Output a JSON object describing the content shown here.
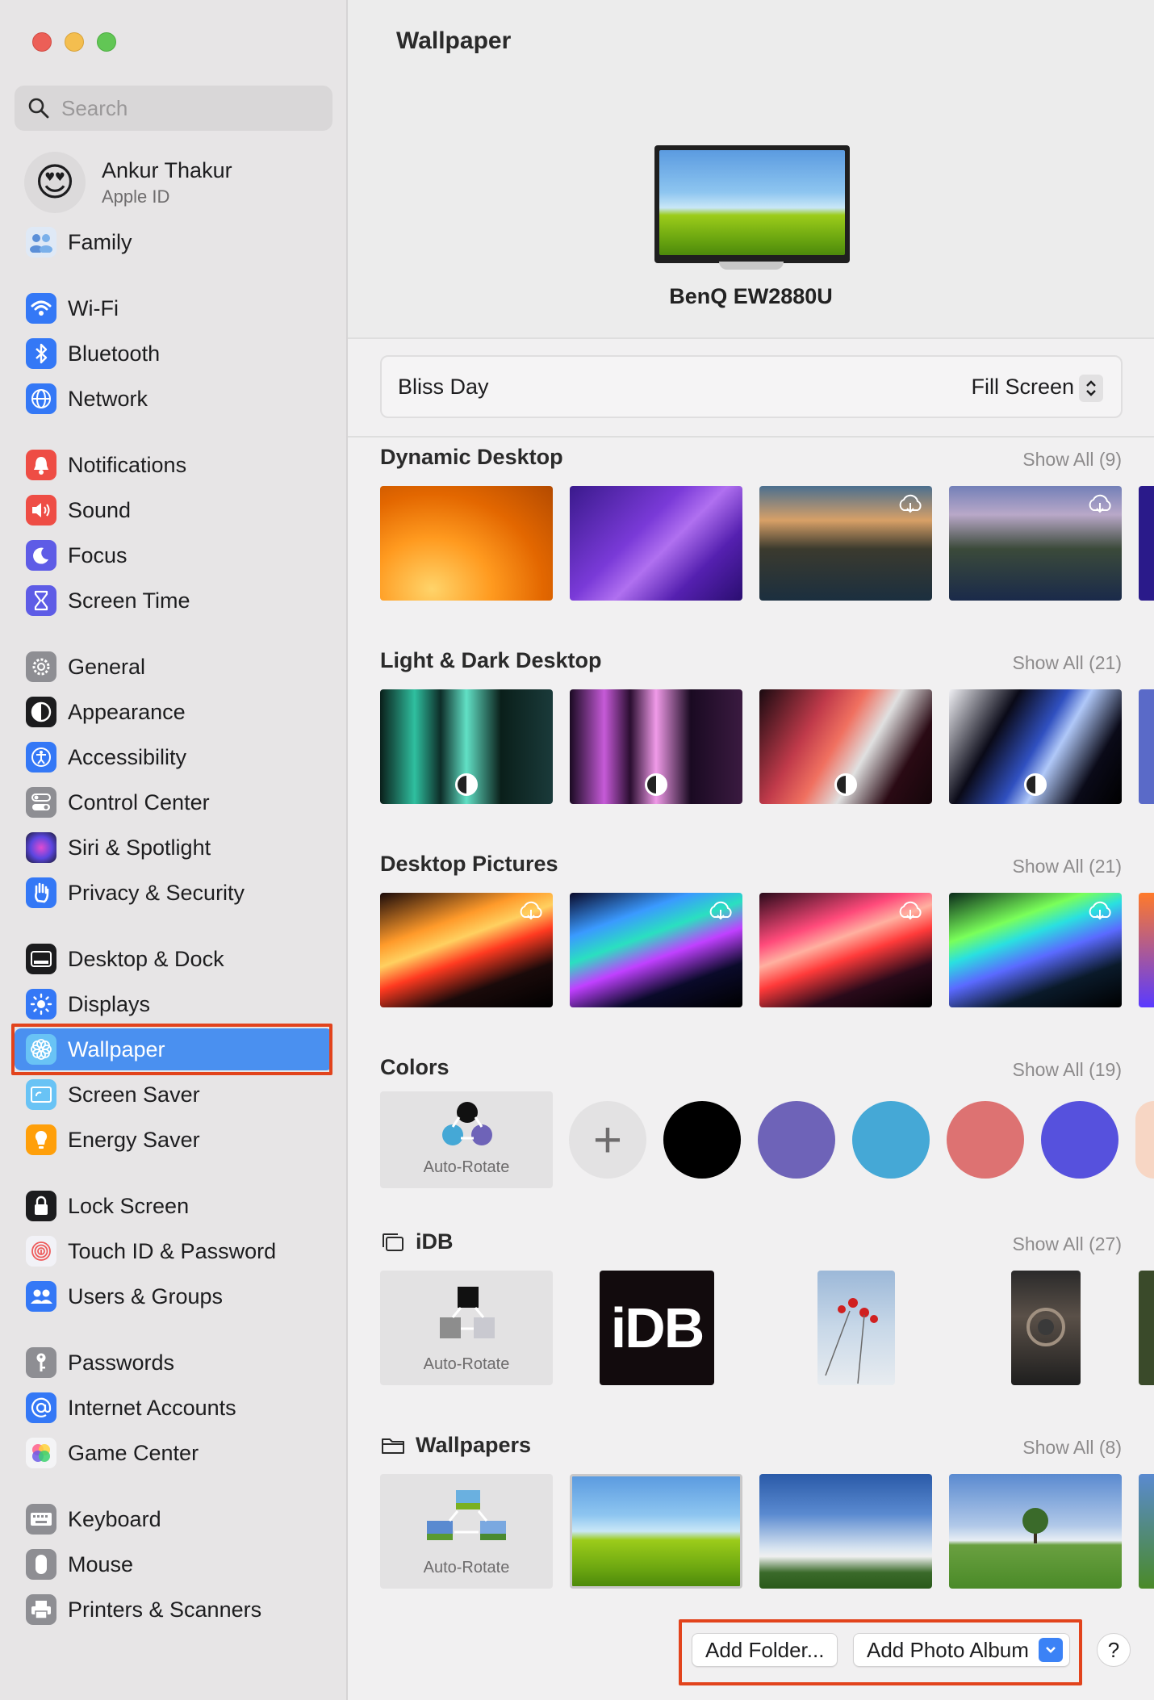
{
  "sidebar": {
    "search_placeholder": "Search",
    "profile": {
      "name": "Ankur Thakur",
      "subtitle": "Apple ID",
      "avatar": "😍"
    },
    "items": [
      {
        "label": "Family",
        "icon": "family-icon",
        "color": "#6fa7e8"
      },
      {
        "label": "Wi-Fi",
        "icon": "wifi-icon",
        "color": "#3478f6"
      },
      {
        "label": "Bluetooth",
        "icon": "bluetooth-icon",
        "color": "#3478f6"
      },
      {
        "label": "Network",
        "icon": "globe-icon",
        "color": "#3478f6"
      },
      {
        "label": "Notifications",
        "icon": "bell-icon",
        "color": "#ee4d45"
      },
      {
        "label": "Sound",
        "icon": "speaker-icon",
        "color": "#ee4d45"
      },
      {
        "label": "Focus",
        "icon": "moon-icon",
        "color": "#5e5ce6"
      },
      {
        "label": "Screen Time",
        "icon": "hourglass-icon",
        "color": "#5e5ce6"
      },
      {
        "label": "General",
        "icon": "gear-icon",
        "color": "#8e8e93"
      },
      {
        "label": "Appearance",
        "icon": "appearance-icon",
        "color": "#1c1c1e"
      },
      {
        "label": "Accessibility",
        "icon": "accessibility-icon",
        "color": "#3478f6"
      },
      {
        "label": "Control Center",
        "icon": "toggles-icon",
        "color": "#8e8e93"
      },
      {
        "label": "Siri & Spotlight",
        "icon": "siri-icon",
        "color": "#7b3bd6"
      },
      {
        "label": "Privacy & Security",
        "icon": "hand-icon",
        "color": "#3478f6"
      },
      {
        "label": "Desktop & Dock",
        "icon": "dock-icon",
        "color": "#1c1c1e"
      },
      {
        "label": "Displays",
        "icon": "sun-icon",
        "color": "#3478f6"
      },
      {
        "label": "Wallpaper",
        "icon": "flower-icon",
        "color": "#5ac8fa"
      },
      {
        "label": "Screen Saver",
        "icon": "screensaver-icon",
        "color": "#5ac8fa"
      },
      {
        "label": "Energy Saver",
        "icon": "bulb-icon",
        "color": "#ff9f0a"
      },
      {
        "label": "Lock Screen",
        "icon": "lock-icon",
        "color": "#1c1c1e"
      },
      {
        "label": "Touch ID & Password",
        "icon": "fingerprint-icon",
        "color": "#f2f2f7"
      },
      {
        "label": "Users & Groups",
        "icon": "users-icon",
        "color": "#3478f6"
      },
      {
        "label": "Passwords",
        "icon": "key-icon",
        "color": "#8e8e93"
      },
      {
        "label": "Internet Accounts",
        "icon": "at-icon",
        "color": "#3478f6"
      },
      {
        "label": "Game Center",
        "icon": "gamecenter-icon",
        "color": "#f2f2f7"
      },
      {
        "label": "Keyboard",
        "icon": "keyboard-icon",
        "color": "#8e8e93"
      },
      {
        "label": "Mouse",
        "icon": "mouse-icon",
        "color": "#8e8e93"
      },
      {
        "label": "Printers & Scanners",
        "icon": "printer-icon",
        "color": "#8e8e93"
      }
    ]
  },
  "main": {
    "title": "Wallpaper",
    "display_name": "BenQ EW2880U",
    "current_wallpaper": "Bliss Day",
    "fit_mode": "Fill Screen",
    "sections": [
      {
        "title": "Dynamic Desktop",
        "show_all": "Show All (9)"
      },
      {
        "title": "Light & Dark Desktop",
        "show_all": "Show All (21)"
      },
      {
        "title": "Desktop Pictures",
        "show_all": "Show All (21)"
      },
      {
        "title": "Colors",
        "show_all": "Show All (19)"
      },
      {
        "title": "iDB",
        "show_all": "Show All (27)"
      },
      {
        "title": "Wallpapers",
        "show_all": "Show All (8)"
      }
    ],
    "auto_rotate": "Auto-Rotate",
    "idb_logo": "iDB",
    "colors": [
      "#000000",
      "#6e63b8",
      "#45a8d6",
      "#dd7272",
      "#5651dd",
      "#f7d6c4"
    ],
    "buttons": {
      "add_folder": "Add Folder...",
      "add_album": "Add Photo Album",
      "help": "?"
    }
  }
}
